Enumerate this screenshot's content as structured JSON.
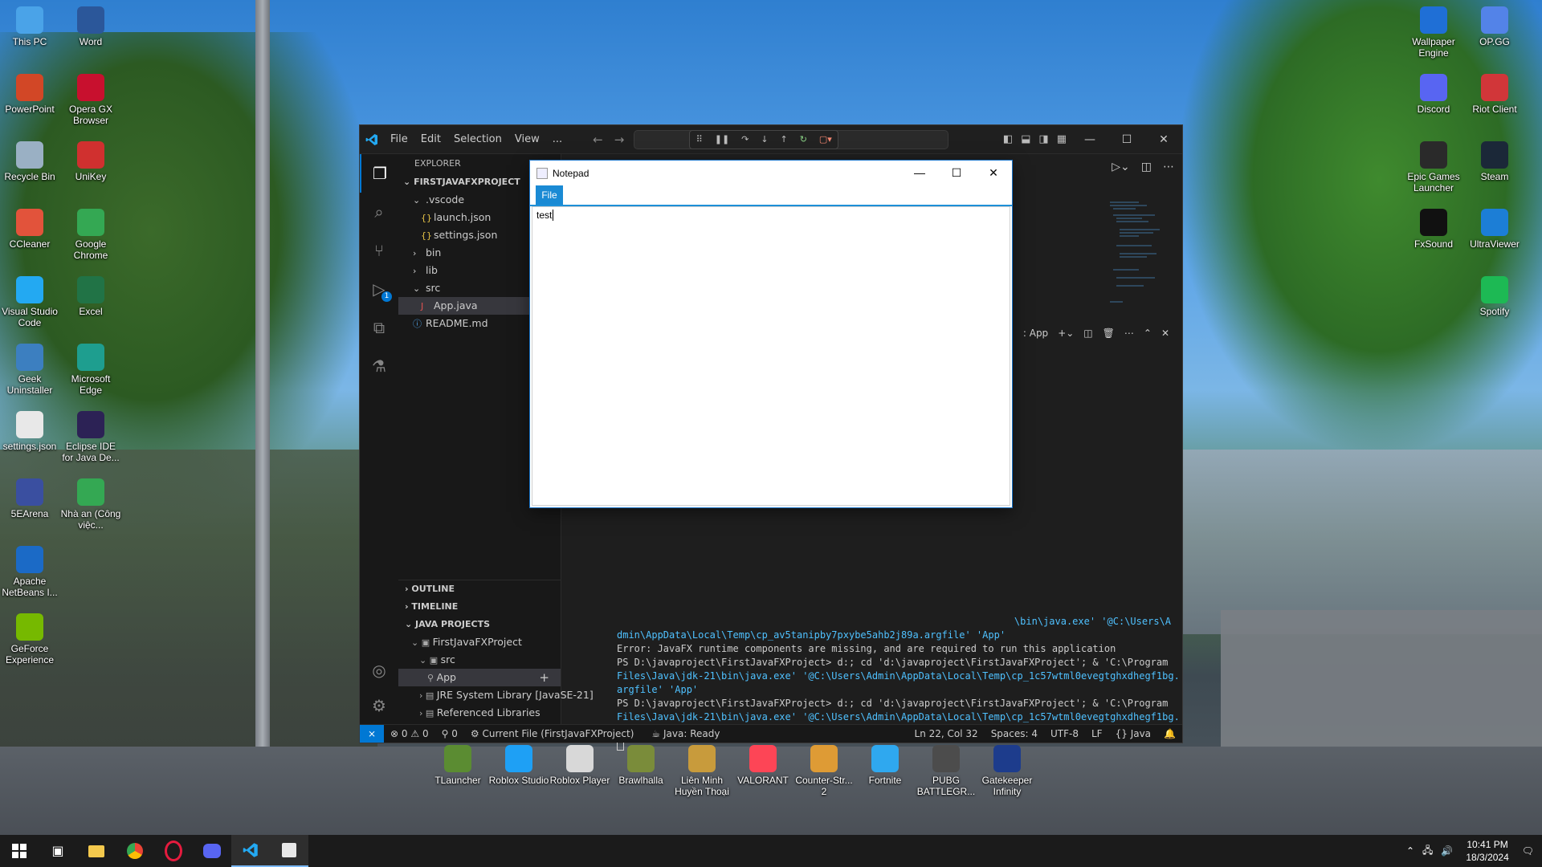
{
  "desktop": {
    "left_icons": [
      {
        "label": "This PC",
        "icon": "computer-icon",
        "color": "#4aa3e8"
      },
      {
        "label": "Word",
        "icon": "word-icon",
        "color": "#2b579a"
      },
      {
        "label": "PowerPoint",
        "icon": "powerpoint-icon",
        "color": "#d24726"
      },
      {
        "label": "Opera GX Browser",
        "icon": "opera-gx-icon",
        "color": "#c8102e"
      },
      {
        "label": "Recycle Bin",
        "icon": "recycle-bin-icon",
        "color": "#9ab0c4"
      },
      {
        "label": "UniKey",
        "icon": "unikey-icon",
        "color": "#d0302f"
      },
      {
        "label": "CCleaner",
        "icon": "ccleaner-icon",
        "color": "#e2533b"
      },
      {
        "label": "Google Chrome",
        "icon": "chrome-icon",
        "color": "#34a853"
      },
      {
        "label": "Visual Studio Code",
        "icon": "vscode-icon",
        "color": "#23a9f2"
      },
      {
        "label": "Excel",
        "icon": "excel-icon",
        "color": "#217346"
      },
      {
        "label": "Geek Uninstaller",
        "icon": "geek-uninstaller-icon",
        "color": "#3c7fc0"
      },
      {
        "label": "Microsoft Edge",
        "icon": "edge-icon",
        "color": "#1e9e8f"
      },
      {
        "label": "settings.json",
        "icon": "json-file-icon",
        "color": "#e8e8e8"
      },
      {
        "label": "Eclipse IDE for Java De...",
        "icon": "eclipse-icon",
        "color": "#2c2255"
      },
      {
        "label": "5EArena",
        "icon": "5earena-icon",
        "color": "#3a4fa0"
      },
      {
        "label": "Nhà an (Công việc...",
        "icon": "chrome-profile-icon",
        "color": "#34a853"
      },
      {
        "label": "Apache NetBeans I...",
        "icon": "netbeans-icon",
        "color": "#1b6ac6"
      },
      {
        "label": "",
        "icon": "",
        "color": ""
      },
      {
        "label": "GeForce Experience",
        "icon": "geforce-icon",
        "color": "#76b900"
      }
    ],
    "right_icons": [
      {
        "label": "Wallpaper Engine",
        "icon": "wallpaper-engine-icon",
        "color": "#1f6fd6"
      },
      {
        "label": "OP.GG",
        "icon": "opgg-icon",
        "color": "#5383e8"
      },
      {
        "label": "Discord",
        "icon": "discord-icon",
        "color": "#5865f2"
      },
      {
        "label": "Riot Client",
        "icon": "riot-client-icon",
        "color": "#d13639"
      },
      {
        "label": "Epic Games Launcher",
        "icon": "epic-games-icon",
        "color": "#2a2a2a"
      },
      {
        "label": "Steam",
        "icon": "steam-icon",
        "color": "#1b2838"
      },
      {
        "label": "FxSound",
        "icon": "fxsound-icon",
        "color": "#111111"
      },
      {
        "label": "UltraViewer",
        "icon": "ultraviewer-icon",
        "color": "#1c7ed6"
      },
      {
        "label": "",
        "icon": "",
        "color": ""
      },
      {
        "label": "Spotify",
        "icon": "spotify-icon",
        "color": "#1db954"
      }
    ],
    "bottom_icons": [
      {
        "label": "TLauncher",
        "icon": "tlauncher-icon",
        "color": "#5b8c32"
      },
      {
        "label": "Roblox Studio",
        "icon": "roblox-studio-icon",
        "color": "#1ea0f5"
      },
      {
        "label": "Roblox Player",
        "icon": "roblox-player-icon",
        "color": "#d8d8d8"
      },
      {
        "label": "Brawlhalla",
        "icon": "brawlhalla-icon",
        "color": "#7a8c3a"
      },
      {
        "label": "Liên Minh Huyền Thoại",
        "icon": "league-icon",
        "color": "#c89b3c"
      },
      {
        "label": "VALORANT",
        "icon": "valorant-icon",
        "color": "#fd4556"
      },
      {
        "label": "Counter-Str... 2",
        "icon": "cs2-icon",
        "color": "#de9b35"
      },
      {
        "label": "Fortnite",
        "icon": "fortnite-icon",
        "color": "#2fa8ef"
      },
      {
        "label": "PUBG BATTLEGR...",
        "icon": "pubg-icon",
        "color": "#4c4c4c"
      },
      {
        "label": "Gatekeeper Infinity",
        "icon": "gatekeeper-icon",
        "color": "#1d3c8c"
      }
    ]
  },
  "vscode": {
    "menu": [
      "File",
      "Edit",
      "Selection",
      "View",
      "..."
    ],
    "explorer_title": "EXPLORER",
    "project_title": "FIRSTJAVAFXPROJECT",
    "tree": [
      {
        "label": ".vscode",
        "indent": 1,
        "kind": "folder-open"
      },
      {
        "label": "launch.json",
        "indent": 2,
        "kind": "json"
      },
      {
        "label": "settings.json",
        "indent": 2,
        "kind": "json"
      },
      {
        "label": "bin",
        "indent": 1,
        "kind": "folder"
      },
      {
        "label": "lib",
        "indent": 1,
        "kind": "folder"
      },
      {
        "label": "src",
        "indent": 1,
        "kind": "folder-open"
      },
      {
        "label": "App.java",
        "indent": 2,
        "kind": "java"
      },
      {
        "label": "README.md",
        "indent": 1,
        "kind": "info"
      }
    ],
    "sections": [
      "OUTLINE",
      "TIMELINE",
      "JAVA PROJECTS"
    ],
    "java_projects": [
      {
        "label": "FirstJavaFXProject",
        "indent": 1
      },
      {
        "label": "src",
        "indent": 2
      },
      {
        "label": "App",
        "indent": 3
      },
      {
        "label": "JRE System Library [JavaSE-21]",
        "indent": 2
      },
      {
        "label": "Referenced Libraries",
        "indent": 2
      }
    ],
    "terminal_tab": ": App",
    "terminal_lines": [
      {
        "text": "\\bin\\java.exe' '@C:\\Users\\A",
        "cls": "t-path",
        "pad": "right"
      },
      {
        "text": "dmin\\AppData\\Local\\Temp\\cp_av5tanipby7pxybe5ahb2j89a.argfile' 'App'",
        "cls": "t-path"
      },
      {
        "text": "Error: JavaFX runtime components are missing, and are required to run this application",
        "cls": ""
      },
      {
        "text": "PS D:\\javaproject\\FirstJavaFXProject>  d:; cd 'd:\\javaproject\\FirstJavaFXProject'; & 'C:\\Program",
        "cls": ""
      },
      {
        "text": "Files\\Java\\jdk-21\\bin\\java.exe' '@C:\\Users\\Admin\\AppData\\Local\\Temp\\cp_1c57wtml0evegtghxdhegf1bg.",
        "cls": "t-path"
      },
      {
        "text": "argfile' 'App'",
        "cls": "t-path"
      },
      {
        "text": "PS D:\\javaproject\\FirstJavaFXProject>  d:; cd 'd:\\javaproject\\FirstJavaFXProject'; & 'C:\\Program",
        "cls": ""
      },
      {
        "text": "Files\\Java\\jdk-21\\bin\\java.exe' '@C:\\Users\\Admin\\AppData\\Local\\Temp\\cp_1c57wtml0evegtghxdhegf1bg.",
        "cls": "t-path"
      },
      {
        "text": "argfile' 'App'",
        "cls": "t-path"
      }
    ],
    "status": {
      "errors": "0",
      "warnings": "0",
      "ports": "0",
      "current_file": "Current File (FirstJavaFXProject)",
      "java": "Java: Ready",
      "position": "Ln 22, Col 32",
      "spaces": "Spaces: 4",
      "encoding": "UTF-8",
      "eol": "LF",
      "language": "Java"
    },
    "debug_badge": "1",
    "accent": "#0078d4"
  },
  "notepad": {
    "title": "Notepad",
    "menu_file": "File",
    "content": "test"
  },
  "taskbar": {
    "time": "10:41 PM",
    "date": "18/3/2024"
  }
}
